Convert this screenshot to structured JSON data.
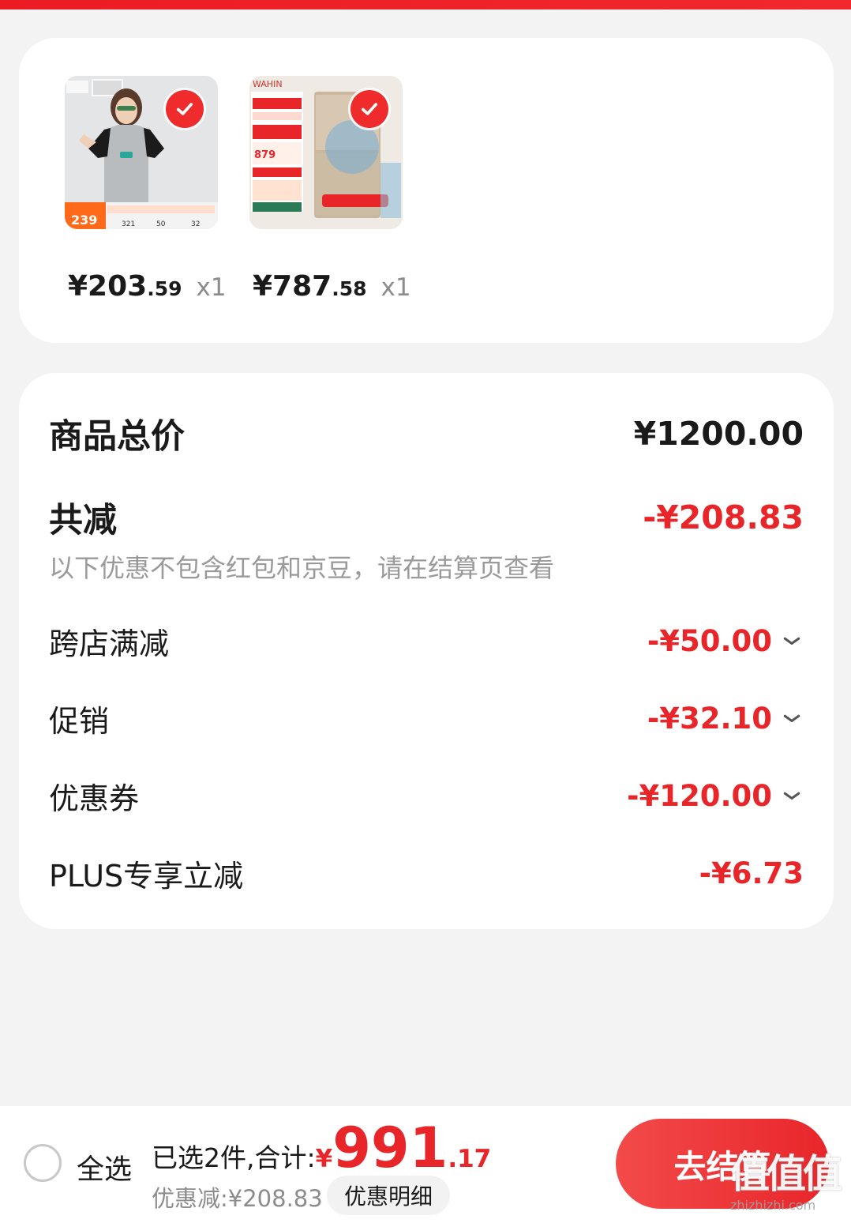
{
  "products": [
    {
      "price_int": "¥203",
      "price_dec": ".59",
      "qty": "x1",
      "image": "tshirt-product-image"
    },
    {
      "price_int": "¥787",
      "price_dec": ".58",
      "qty": "x1",
      "image": "fridge-product-image"
    }
  ],
  "summary": {
    "total_label": "商品总价",
    "total_value": "¥1200.00",
    "reduce_label": "共减",
    "reduce_value": "-¥208.83",
    "note": "以下优惠不包含红包和京豆，请在结算页查看",
    "items": [
      {
        "label": "跨店满减",
        "value": "-¥50.00",
        "expandable": true
      },
      {
        "label": "促销",
        "value": "-¥32.10",
        "expandable": true
      },
      {
        "label": "优惠券",
        "value": "-¥120.00",
        "expandable": true
      },
      {
        "label": "PLUS专享立减",
        "value": "-¥6.73",
        "expandable": false
      }
    ]
  },
  "bottom": {
    "select_all": "全选",
    "selected_total_label": "已选2件,合计:",
    "currency": "¥",
    "total_int": "991",
    "total_dec": ".17",
    "discount": "优惠减:¥208.83",
    "detail_button": "优惠明细",
    "checkout_button": "去结算"
  },
  "watermark": {
    "logo": "值值值",
    "url": "zhizhizhi.com"
  },
  "colors": {
    "accent": "#e8262a",
    "background": "#f3f3f3"
  }
}
